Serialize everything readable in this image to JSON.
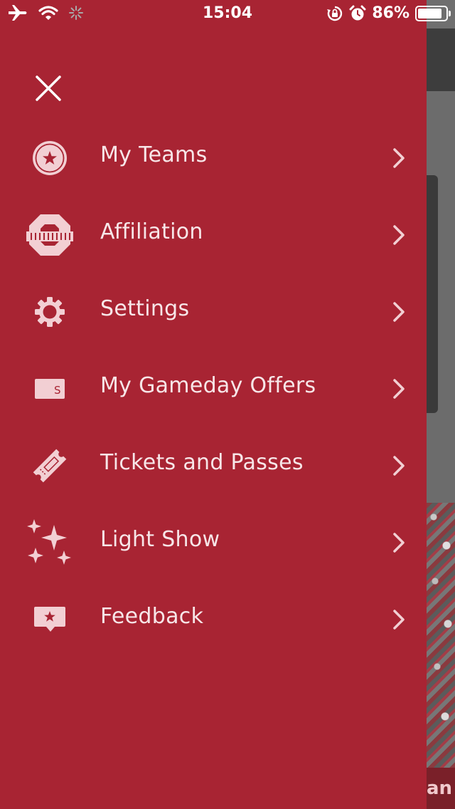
{
  "status_bar": {
    "time": "15:04",
    "battery_percent": "86%",
    "battery_level": 0.86
  },
  "drawer": {
    "close_icon": "close-icon",
    "items": [
      {
        "label": "My Teams",
        "icon": "star-badge-icon"
      },
      {
        "label": "Affiliation",
        "icon": "block-o-logo-icon"
      },
      {
        "label": "Settings",
        "icon": "gear-icon"
      },
      {
        "label": "My Gameday Offers",
        "icon": "dollar-bill-icon"
      },
      {
        "label": "Tickets and Passes",
        "icon": "ticket-icon"
      },
      {
        "label": "Light Show",
        "icon": "sparkles-icon"
      },
      {
        "label": "Feedback",
        "icon": "feedback-bubble-icon"
      }
    ]
  },
  "background": {
    "banner_text": "an C"
  },
  "colors": {
    "drawer": "#a82433",
    "icon": "#f2cfd3",
    "text": "#f7e6e8"
  }
}
